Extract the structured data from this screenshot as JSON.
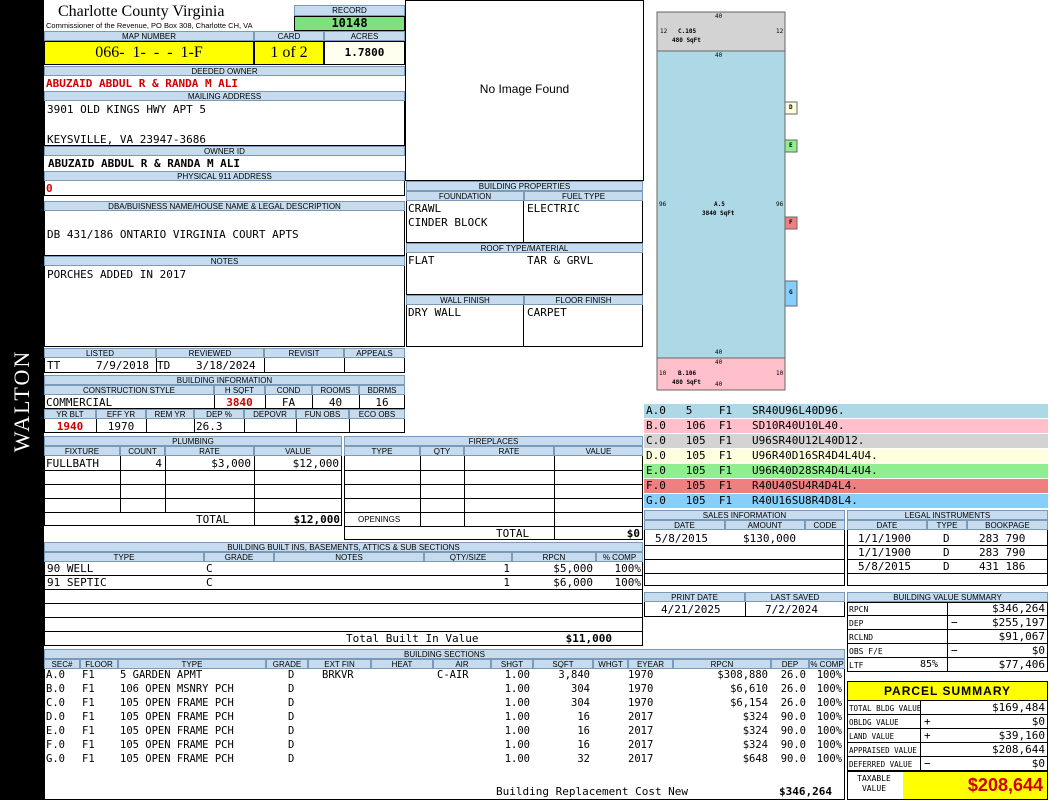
{
  "sidebar": {
    "label": "WALTON"
  },
  "header": {
    "county": "Charlotte County Virginia",
    "commissioner": "Commissioner of the Revenue, PO Box 308, Charlotte CH, VA",
    "record_label": "RECORD",
    "record": "10148",
    "map_label": "MAP NUMBER",
    "map": "066-  1-  -  -  1-F",
    "card_label": "CARD",
    "card": "1 of 2",
    "acres_label": "ACRES",
    "acres": "1.7800"
  },
  "owner": {
    "deeded_label": "DEEDED OWNER",
    "deeded": "ABUZAID ABDUL R & RANDA M ALI",
    "mailing_label": "MAILING ADDRESS",
    "addr1": "3901 OLD KINGS HWY APT 5",
    "addr2": "KEYSVILLE, VA 23947-3686",
    "ownerid_label": "OWNER ID",
    "ownerid": "ABUZAID ABDUL R & RANDA M ALI",
    "phys_label": "PHYSICAL 911 ADDRESS",
    "phys": "0",
    "dba_label": "DBA/BUISNESS NAME/HOUSE NAME & LEGAL DESCRIPTION",
    "dba": "DB 431/186 ONTARIO VIRGINIA COURT APTS",
    "notes_label": "NOTES",
    "notes": "PORCHES ADDED IN 2017"
  },
  "image": {
    "text": "No Image Found"
  },
  "bprop": {
    "title": "BUILDING PROPERTIES",
    "foundation_label": "FOUNDATION",
    "fuel_label": "FUEL TYPE",
    "foundation1": "CRAWL",
    "foundation2": "CINDER BLOCK",
    "fuel": "ELECTRIC",
    "roof_label": "ROOF TYPE/MATERIAL",
    "roof1": "FLAT",
    "roof2": "TAR & GRVL",
    "wall_label": "WALL FINISH",
    "floor_label": "FLOOR FINISH",
    "wall": "DRY WALL",
    "floor": "CARPET"
  },
  "listing": {
    "listed_label": "LISTED",
    "reviewed_label": "REVIEWED",
    "revisit_label": "REVISIT",
    "appeals_label": "APPEALS",
    "code1": "TT",
    "listed": "7/9/2018",
    "code2": "TD",
    "reviewed": "3/18/2024"
  },
  "binfo": {
    "title": "BUILDING INFORMATION",
    "cs_label": "CONSTRUCTION STYLE",
    "hsqft_label": "H SQFT",
    "cond_label": "COND",
    "rooms_label": "ROOMS",
    "bdrms_label": "BDRMS",
    "cs": "COMMERCIAL",
    "hsqft": "3840",
    "cond": "FA",
    "rooms": "40",
    "bdrms": "16",
    "yrblt_label": "YR BLT",
    "effyr_label": "EFF YR",
    "remyr_label": "REM YR",
    "dep_label": "DEP %",
    "depovr_label": "DEPOVR",
    "funobs_label": "FUN OBS",
    "ecoobs_label": "ECO OBS",
    "yrblt": "1940",
    "effyr": "1970",
    "dep": "26.3"
  },
  "plumbing": {
    "title": "PLUMBING",
    "headers": [
      "FIXTURE",
      "COUNT",
      "RATE",
      "VALUE"
    ],
    "fixture": "FULLBATH",
    "count": "4",
    "rate": "$3,000",
    "value": "$12,000",
    "total_label": "TOTAL",
    "total": "$12,000"
  },
  "fireplaces": {
    "title": "FIREPLACES",
    "headers": [
      "TYPE",
      "QTY",
      "RATE",
      "VALUE"
    ],
    "openings_label": "OPENINGS",
    "total_label": "TOTAL",
    "total": "$0"
  },
  "builtins": {
    "title": "BUILDING BUILT INS, BASEMENTS, ATTICS & SUB SECTIONS",
    "headers": [
      "TYPE",
      "GRADE",
      "NOTES",
      "QTY/SIZE",
      "RPCN",
      "% COMP"
    ],
    "rows": [
      {
        "type": "90 WELL",
        "grade": "C",
        "qty": "1",
        "rpcn": "$5,000",
        "comp": "100%"
      },
      {
        "type": "91 SEPTIC",
        "grade": "C",
        "qty": "1",
        "rpcn": "$6,000",
        "comp": "100%"
      }
    ],
    "total_label": "Total Built In Value",
    "total": "$11,000"
  },
  "sections": {
    "title": "BUILDING SECTIONS",
    "headers": [
      "SEC#",
      "FLOOR",
      "TYPE",
      "GRADE",
      "EXT FIN",
      "HEAT",
      "AIR",
      "SHGT",
      "SQFT",
      "WHGT",
      "EYEAR",
      "RPCN",
      "DEP",
      "% COMP"
    ],
    "rows": [
      {
        "sec": "A.0",
        "floor": "F1",
        "type": "5 GARDEN APMT",
        "grade": "D",
        "ext": "BRKVR",
        "heat": "",
        "air": "C-AIR",
        "shgt": "1.00",
        "sqft": "3,840",
        "eyear": "1970",
        "rpcn": "$308,880",
        "dep": "26.0",
        "comp": "100%"
      },
      {
        "sec": "B.0",
        "floor": "F1",
        "type": "106 OPEN MSNRY PCH",
        "grade": "D",
        "ext": "",
        "heat": "",
        "air": "",
        "shgt": "1.00",
        "sqft": "304",
        "eyear": "1970",
        "rpcn": "$6,610",
        "dep": "26.0",
        "comp": "100%"
      },
      {
        "sec": "C.0",
        "floor": "F1",
        "type": "105 OPEN FRAME PCH",
        "grade": "D",
        "ext": "",
        "heat": "",
        "air": "",
        "shgt": "1.00",
        "sqft": "304",
        "eyear": "1970",
        "rpcn": "$6,154",
        "dep": "26.0",
        "comp": "100%"
      },
      {
        "sec": "D.0",
        "floor": "F1",
        "type": "105 OPEN FRAME PCH",
        "grade": "D",
        "ext": "",
        "heat": "",
        "air": "",
        "shgt": "1.00",
        "sqft": "16",
        "eyear": "2017",
        "rpcn": "$324",
        "dep": "90.0",
        "comp": "100%"
      },
      {
        "sec": "E.0",
        "floor": "F1",
        "type": "105 OPEN FRAME PCH",
        "grade": "D",
        "ext": "",
        "heat": "",
        "air": "",
        "shgt": "1.00",
        "sqft": "16",
        "eyear": "2017",
        "rpcn": "$324",
        "dep": "90.0",
        "comp": "100%"
      },
      {
        "sec": "F.0",
        "floor": "F1",
        "type": "105 OPEN FRAME PCH",
        "grade": "D",
        "ext": "",
        "heat": "",
        "air": "",
        "shgt": "1.00",
        "sqft": "16",
        "eyear": "2017",
        "rpcn": "$324",
        "dep": "90.0",
        "comp": "100%"
      },
      {
        "sec": "G.0",
        "floor": "F1",
        "type": "105 OPEN FRAME PCH",
        "grade": "D",
        "ext": "",
        "heat": "",
        "air": "",
        "shgt": "1.00",
        "sqft": "32",
        "eyear": "2017",
        "rpcn": "$648",
        "dep": "90.0",
        "comp": "100%"
      }
    ],
    "rcn_label": "Building Replacement Cost New",
    "rcn": "$346,264"
  },
  "sketch": {
    "c_label": "C.105",
    "c_area": "480 SqFt",
    "a_label": "A.5",
    "a_area": "3840 SqFt",
    "b_label": "B.106",
    "b_area": "480 SqFt",
    "dim_40": "40",
    "dim_12": "12",
    "dim_96": "96",
    "dim_10": "10",
    "d": "D",
    "e": "E",
    "f": "F",
    "g": "G"
  },
  "vectors": [
    {
      "text": "A.0   5    F1   SR40U96L40D96.",
      "color": "#add8e6"
    },
    {
      "text": "B.0   106  F1   SD10R40U10L40.",
      "color": "#ffc0cb"
    },
    {
      "text": "C.0   105  F1   U96SR40U12L40D12.",
      "color": "#d3d3d3"
    },
    {
      "text": "D.0   105  F1   U96R40D16SR4D4L4U4.",
      "color": "#ffffe0"
    },
    {
      "text": "E.0   105  F1   U96R40D28SR4D4L4U4.",
      "color": "#90ee90"
    },
    {
      "text": "F.0   105  F1   R40U40SU4R4D4L4.",
      "color": "#f08080"
    },
    {
      "text": "G.0   105  F1   R40U16SU8R4D8L4.",
      "color": "#87cefa"
    }
  ],
  "sales": {
    "title": "SALES INFORMATION",
    "headers": [
      "DATE",
      "AMOUNT",
      "CODE"
    ],
    "date": "5/8/2015",
    "amount": "$130,000"
  },
  "legal": {
    "title": "LEGAL INSTRUMENTS",
    "headers": [
      "DATE",
      "TYPE",
      "BOOKPAGE"
    ],
    "rows": [
      {
        "date": "1/1/1900",
        "type": "D",
        "book": "283 790"
      },
      {
        "date": "1/1/1900",
        "type": "D",
        "book": "283 790"
      },
      {
        "date": "5/8/2015",
        "type": "D",
        "book": "431 186"
      }
    ]
  },
  "dates": {
    "print_label": "PRINT DATE",
    "saved_label": "LAST SAVED",
    "print": "4/21/2025",
    "saved": "7/2/2024"
  },
  "bvs": {
    "title": "BUILDING VALUE SUMMARY",
    "rows": [
      {
        "label": "RPCN",
        "sign": "",
        "pct": "",
        "value": "$346,264"
      },
      {
        "label": "DEP",
        "sign": "−",
        "pct": "",
        "value": "$255,197"
      },
      {
        "label": "RCLND",
        "sign": "",
        "pct": "",
        "value": "$91,067"
      },
      {
        "label": "OBS F/E",
        "sign": "−",
        "pct": "",
        "value": "$0"
      },
      {
        "label": "LTF",
        "sign": "",
        "pct": "85%",
        "value": "$77,406"
      }
    ]
  },
  "parcel": {
    "title": "PARCEL SUMMARY",
    "rows": [
      {
        "label": "TOTAL BLDG VALUE",
        "sign": "",
        "value": "$169,484"
      },
      {
        "label": "OBLDG VALUE",
        "sign": "+",
        "value": "$0"
      },
      {
        "label": "LAND VALUE",
        "sign": "+",
        "value": "$39,160"
      },
      {
        "label": "APPRAISED VALUE",
        "sign": "",
        "value": "$208,644"
      },
      {
        "label": "DEFERRED VALUE",
        "sign": "−",
        "value": "$0"
      }
    ],
    "taxable_label1": "TAXABLE",
    "taxable_label2": "VALUE",
    "taxable": "$208,644"
  },
  "colors": {
    "accent_yellow": "#ffff00",
    "header_blue": "#c6dcee",
    "record_green": "#7ee07e",
    "value_red": "#d00000"
  }
}
